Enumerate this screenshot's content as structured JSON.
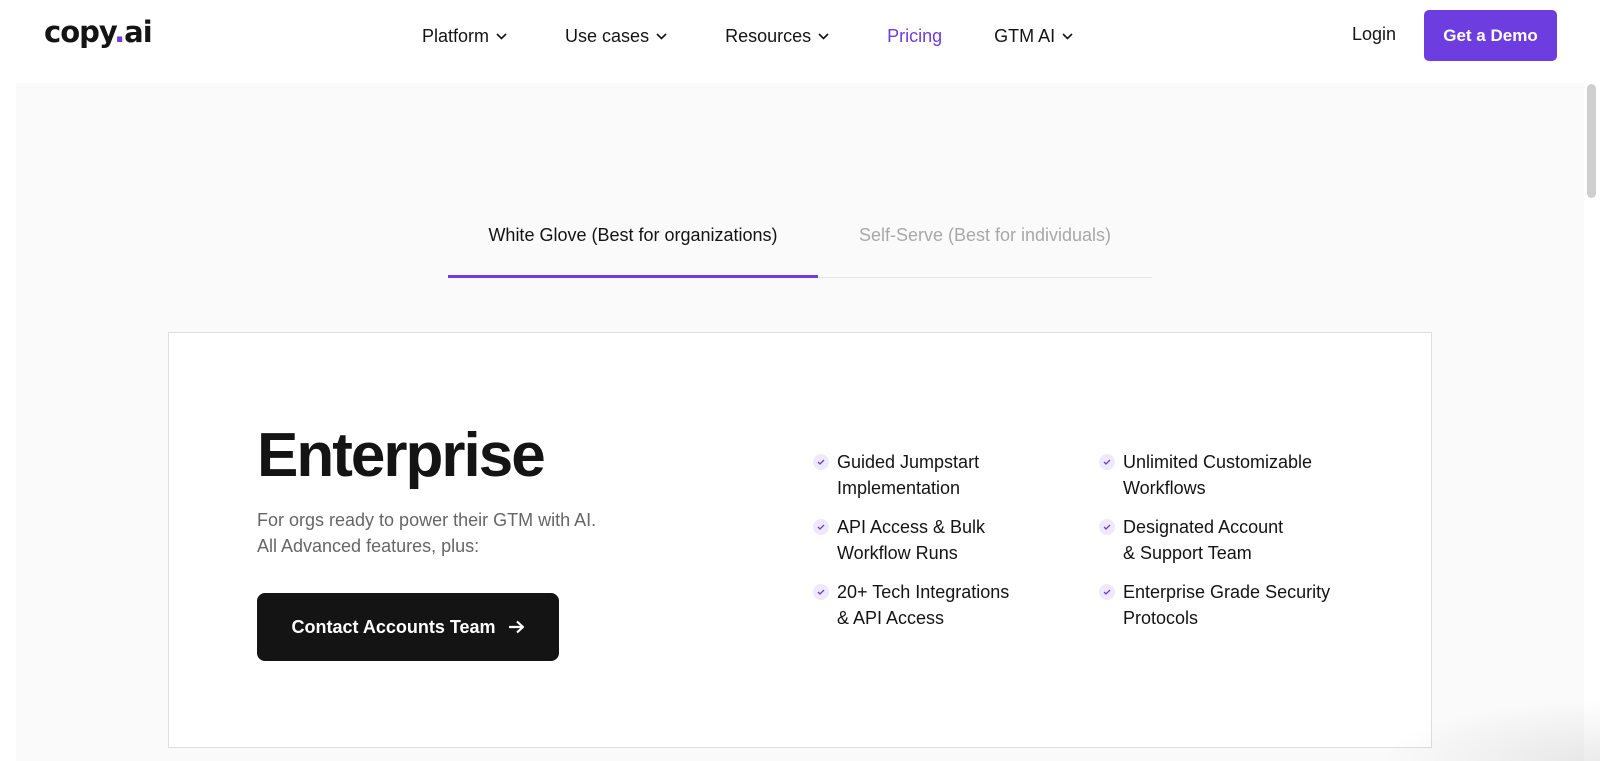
{
  "header": {
    "logo": {
      "main": "copy",
      "dot": ".",
      "suffix": "ai"
    },
    "nav": [
      {
        "label": "Platform",
        "has_menu": true,
        "active": false
      },
      {
        "label": "Use cases",
        "has_menu": true,
        "active": false
      },
      {
        "label": "Resources",
        "has_menu": true,
        "active": false
      },
      {
        "label": "Pricing",
        "has_menu": false,
        "active": true
      },
      {
        "label": "GTM AI",
        "has_menu": true,
        "active": false
      }
    ],
    "login_label": "Login",
    "demo_label": "Get a Demo"
  },
  "tabs": {
    "white_glove": "White Glove (Best for organizations)",
    "self_serve": "Self-Serve (Best for individuals)",
    "selected": "white_glove"
  },
  "plan": {
    "title": "Enterprise",
    "description_lines": [
      "For orgs ready to power their GTM with AI.",
      "All Advanced features, plus:"
    ],
    "cta_label": "Contact Accounts Team",
    "features": [
      {
        "lines": [
          "Guided Jumpstart",
          "Implementation"
        ]
      },
      {
        "lines": [
          "Unlimited Customizable",
          "Workflows"
        ]
      },
      {
        "lines": [
          "API Access & Bulk",
          "Workflow Runs"
        ]
      },
      {
        "lines": [
          "Designated Account",
          "& Support Team"
        ]
      },
      {
        "lines": [
          "20+ Tech Integrations",
          "& API Access"
        ]
      },
      {
        "lines": [
          "Enterprise Grade Security",
          "Protocols"
        ]
      }
    ]
  },
  "colors": {
    "accent": "#6d3ddf",
    "dark_button": "#141414",
    "panel_background": "#fafafa",
    "muted_text": "#666666",
    "inactive_tab": "#a8a8a8"
  },
  "icons": {
    "nav_menu": "chevron-down-icon",
    "cta": "arrow-right-icon",
    "feature": "check-icon"
  }
}
